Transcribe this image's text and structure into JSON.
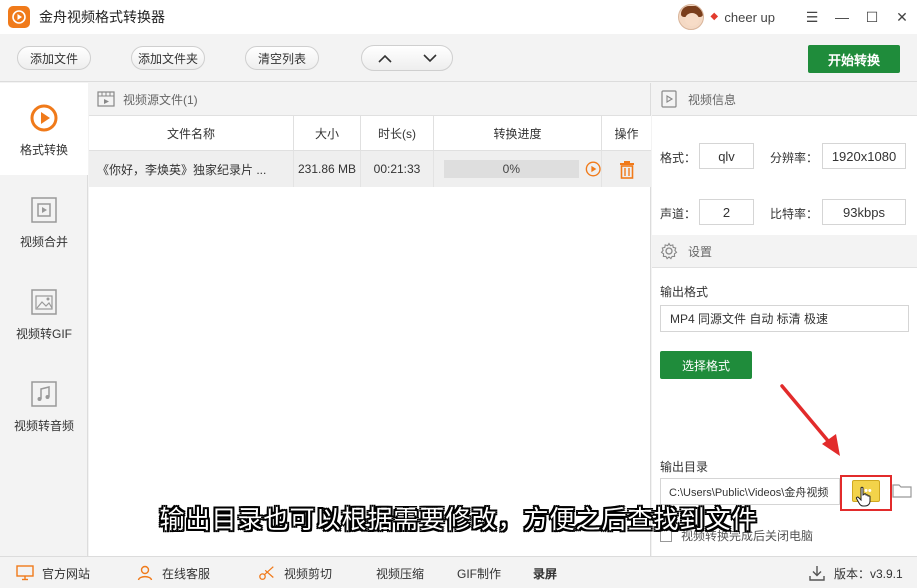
{
  "app": {
    "title": "金舟视频格式转换器"
  },
  "user": {
    "name": "cheer up"
  },
  "window": {
    "minimize": "—",
    "restore": "☐",
    "close": "✕",
    "menu": "☰"
  },
  "toolbar": {
    "add_file": "添加文件",
    "add_folder": "添加文件夹",
    "clear_list": "清空列表",
    "start": "开始转换"
  },
  "nav": [
    {
      "label": "格式转换",
      "icon": "play-circle-icon",
      "active": true
    },
    {
      "label": "视频合并",
      "icon": "video-merge-icon",
      "active": false
    },
    {
      "label": "视频转GIF",
      "icon": "image-icon",
      "active": false
    },
    {
      "label": "视频转音频",
      "icon": "music-note-icon",
      "active": false
    }
  ],
  "file_panel": {
    "title": "视频源文件(1)",
    "columns": [
      "文件名称",
      "大小",
      "时长(s)",
      "转换进度",
      "操作"
    ],
    "rows": [
      {
        "name": "《你好，李焕英》独家纪录片 ...",
        "size": "231.86 MB",
        "duration": "00:21:33",
        "progress": "0%"
      }
    ]
  },
  "video_info": {
    "title": "视频信息",
    "format_label": "格式：",
    "format_value": "qlv",
    "resolution_label": "分辨率：",
    "resolution_value": "1920x1080",
    "channel_label": "声道：",
    "channel_value": "2",
    "bitrate_label": "比特率：",
    "bitrate_value": "93kbps"
  },
  "settings": {
    "title": "设置",
    "output_format_label": "输出格式",
    "output_format_value": "MP4 同源文件 自动 标清 极速",
    "choose_format": "选择格式",
    "output_dir_label": "输出目录",
    "output_dir_value": "C:\\Users\\Public\\Videos\\金舟视频",
    "dir_button": "•••",
    "shutdown_label": "视频转换完成后关闭电脑"
  },
  "subtitle": "输出目录也可以根据需要修改，方便之后查找到文件",
  "statusbar": {
    "website": "官方网站",
    "service": "在线客服",
    "video_edit": "视频剪切",
    "video_compress": "视频压缩",
    "gif_make": "GIF制作",
    "record": "录屏",
    "version": "版本：v3.9.1"
  },
  "colors": {
    "accent_green": "#1f8c3b",
    "brand_orange": "#f07a1a",
    "highlight_red": "#e22b2b"
  }
}
